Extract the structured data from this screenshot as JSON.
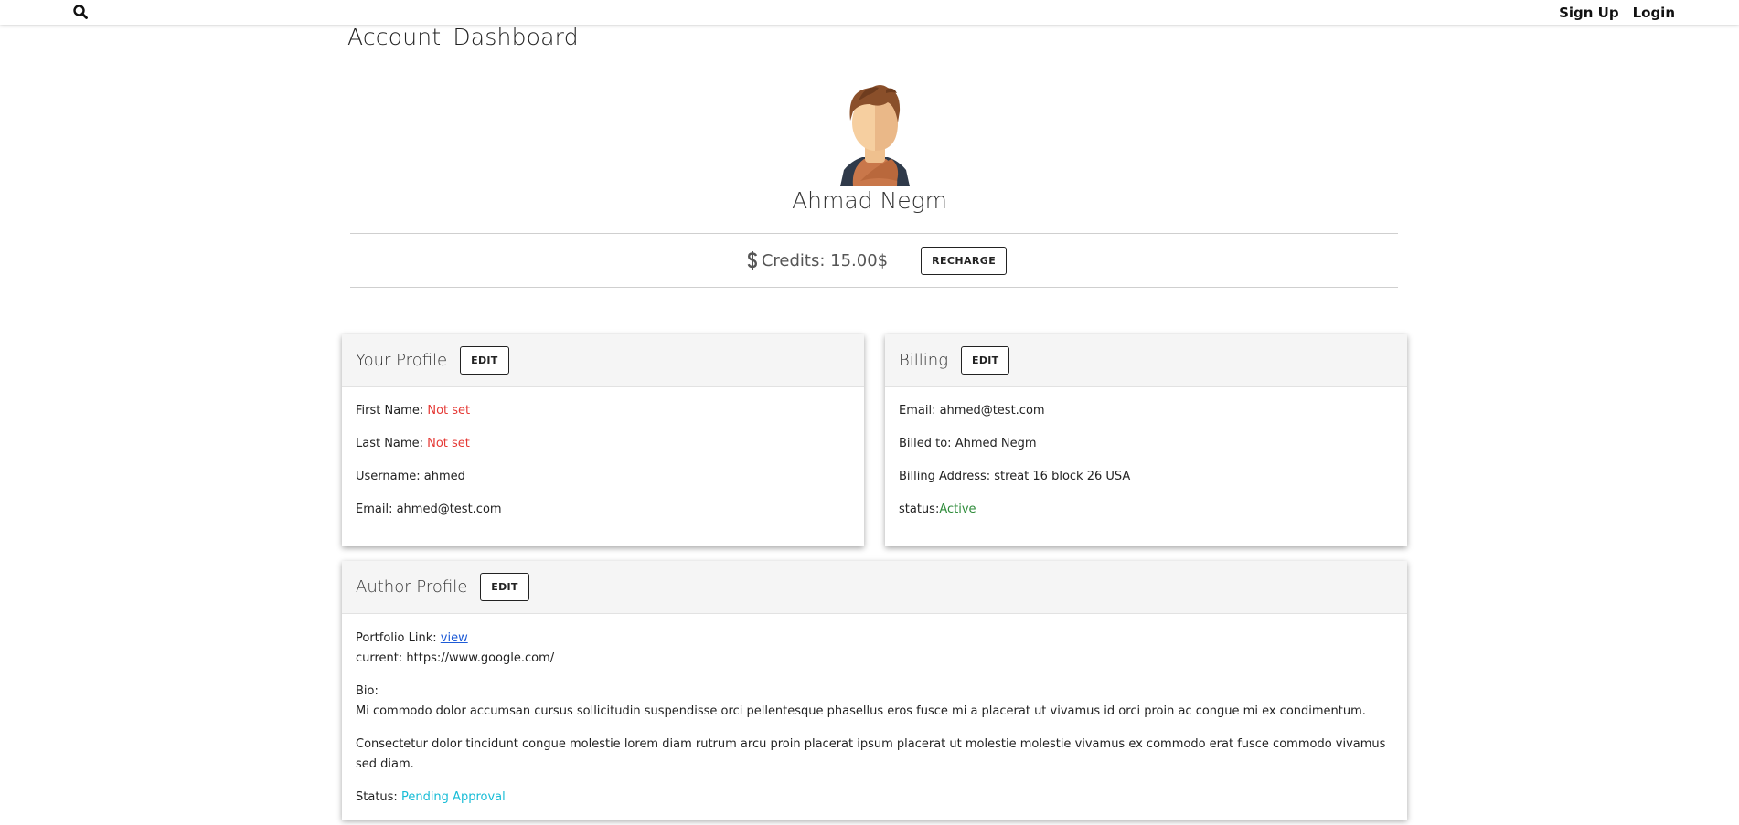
{
  "topbar": {
    "search_icon": "search-icon",
    "signup_label": "Sign Up",
    "login_label": "Login"
  },
  "page": {
    "title_word1": "Account",
    "title_word2": "Dashboard"
  },
  "user": {
    "avatar_icon": "user-avatar",
    "name": "Ahmad Negm"
  },
  "credits": {
    "icon": "dollar-icon",
    "label": "Credits: 15.00$",
    "recharge_label": "RECHARGE"
  },
  "profile_card": {
    "title": "Your Profile",
    "edit_label": "EDIT",
    "first_name_label": "First Name:",
    "first_name_value": "Not set",
    "last_name_label": "Last Name:",
    "last_name_value": "Not set",
    "username_label": "Username:",
    "username_value": "ahmed",
    "email_label": "Email:",
    "email_value": "ahmed@test.com"
  },
  "billing_card": {
    "title": "Billing",
    "edit_label": "EDIT",
    "email_label": "Email:",
    "email_value": "ahmed@test.com",
    "billed_to_label": "Billed to:",
    "billed_to_value": "Ahmed Negm",
    "address_label": "Billing Address:",
    "address_value": "streat 16 block 26 USA",
    "status_label": "status:",
    "status_value": "Active"
  },
  "author_card": {
    "title": "Author Profile",
    "edit_label": "EDIT",
    "portfolio_label": "Portfolio Link:",
    "portfolio_link": "view",
    "current_label": "current:",
    "current_value": "https://www.google.com/",
    "bio_label": "Bio:",
    "bio_p1": "Mi commodo dolor accumsan cursus sollicitudin suspendisse orci pellentesque phasellus eros fusce mi a placerat ut vivamus id orci proin ac congue mi ex condimentum.",
    "bio_p2": "Consectetur dolor tincidunt congue molestie lorem diam rutrum arcu proin placerat ipsum placerat ut molestie molestie vivamus ex commodo erat fusce commodo vivamus sed diam.",
    "status_label": "Status:",
    "status_value": "Pending Approval"
  },
  "colors": {
    "not_set": "#e53935",
    "active": "#2e8b3a",
    "pending": "#17bcd6",
    "link": "#1e5bd6"
  }
}
